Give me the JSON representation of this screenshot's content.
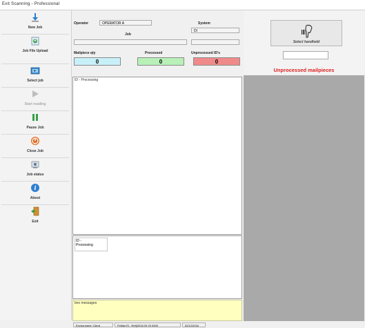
{
  "window": {
    "title": "Exit Scanning - Professional"
  },
  "sidebar": {
    "items": [
      {
        "label": "New Job",
        "icon": "arrow-down-icon",
        "enabled": true
      },
      {
        "label": "Job File Upload",
        "icon": "file-upload-icon",
        "enabled": true
      },
      {
        "label": "Select job",
        "icon": "select-job-icon",
        "enabled": true
      },
      {
        "label": "Start reading",
        "icon": "play-icon",
        "enabled": false
      },
      {
        "label": "Pause Job",
        "icon": "pause-icon",
        "enabled": true
      },
      {
        "label": "Close Job",
        "icon": "power-icon",
        "enabled": true
      },
      {
        "label": "Job status",
        "icon": "job-status-icon",
        "enabled": true
      },
      {
        "label": "About",
        "icon": "info-icon",
        "enabled": true
      },
      {
        "label": "Exit",
        "icon": "exit-door-icon",
        "enabled": true
      }
    ]
  },
  "info": {
    "operator_label": "Operator",
    "operator_value": "OPERATOR A",
    "system_label": "System",
    "system_value": "DI",
    "system_value2": "",
    "job_label": "Job",
    "job_value": "",
    "mailpiece_label": "Mailpiece qty",
    "mailpiece_value": "0",
    "processed_label": "Processed",
    "processed_value": "0",
    "unprocessed_label": "Unprocessed ID's",
    "unprocessed_value": "0"
  },
  "right": {
    "select_handheld_label": "Select handheld",
    "handheld_value": "",
    "unprocessed_mailpieces_label": "Unprocessed mailpieces"
  },
  "panels": {
    "processing_header": "ID - Processing",
    "processing2_line1": "ID -",
    "processing2_line2": "Processing",
    "box_messages": "box messages"
  },
  "statusbar": {
    "cell1": "Environment: Client",
    "cell2": "PcMan70 - Ref§2016 09 20 0000",
    "cell3": "02/12/2016"
  },
  "colors": {
    "mailpiece_bg": "#c8f0f8",
    "processed_bg": "#b8f0b8",
    "unprocessed_bg": "#f08a8a",
    "unprocessed_text": "#e02020",
    "messages_bg": "#ffffc0"
  }
}
